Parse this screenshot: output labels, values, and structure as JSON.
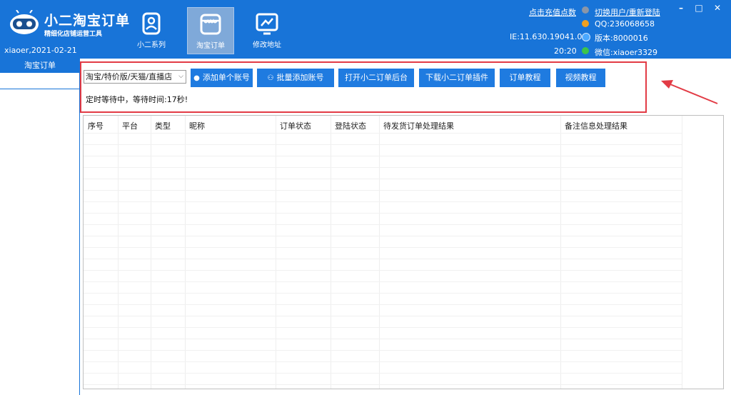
{
  "header": {
    "app_name": "小二淘宝订单",
    "slogan": "精细化店铺运营工具",
    "user_date": "xiaoer,2021-02-21",
    "nav": [
      {
        "label": "小二系列",
        "icon": "contact-card-icon"
      },
      {
        "label": "淘宝订单",
        "icon": "store-icon",
        "active": true
      },
      {
        "label": "修改地址",
        "icon": "line-chart-icon"
      }
    ],
    "recharge_link": "点击充值点数",
    "switch_user_link": "切换用户/重新登陆",
    "qq": "QQ:236068658",
    "ie_version": "IE:11.630.19041.0",
    "version": "版本:8000016",
    "time": "20:20",
    "wechat": "微信:xiaoer3329",
    "minimize": "–",
    "maximize": "□",
    "close": "✕"
  },
  "sidebar": {
    "tab_label": "淘宝订单"
  },
  "toolbar": {
    "platform_select": "淘宝/特价版/天猫/直播店",
    "buttons": [
      {
        "label": "添加单个账号",
        "icon": "person-icon"
      },
      {
        "label": "批量添加账号",
        "icon": "people-icon"
      },
      {
        "label": "打开小二订单后台"
      },
      {
        "label": "下载小二订单插件"
      },
      {
        "label": "订单教程"
      },
      {
        "label": "视频教程"
      }
    ],
    "status_text": "定时等待中，等待时间:17秒!"
  },
  "table": {
    "columns": [
      "序号",
      "平台",
      "类型",
      "昵称",
      "订单状态",
      "登陆状态",
      "待发货订单处理结果",
      "备注信息处理结果"
    ],
    "rows": []
  },
  "colors": {
    "accent": "#1874d8",
    "button": "#1f7be0",
    "highlight": "#e23b45"
  }
}
